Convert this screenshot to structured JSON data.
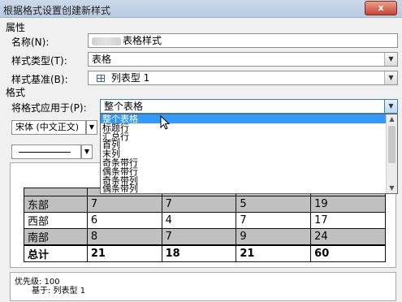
{
  "window": {
    "title": "根据格式设置创建新样式",
    "close_glyph": "x"
  },
  "properties": {
    "section_label": "属性",
    "name_label": "名称(N):",
    "name_value_suffix": "表格样式",
    "type_label": "样式类型(T):",
    "type_value": "表格",
    "based_on_label": "样式基准(B):",
    "based_on_value": "列表型 1",
    "based_on_icon": "table-icon"
  },
  "format": {
    "section_label": "格式",
    "apply_to_label": "将格式应用于(P):",
    "apply_to_value": "整个表格",
    "font_value": "宋体 (中文正文)",
    "apply_options": [
      "整个表格",
      "标题行",
      "汇总行",
      "首列",
      "末列",
      "奇条带行",
      "偶条带行",
      "奇条带列",
      "偶条带列"
    ],
    "selected_option_index": 0
  },
  "preview_table": {
    "rows": [
      {
        "style": "hdr",
        "cells": [
          "",
          "",
          "",
          "",
          ""
        ]
      },
      {
        "style": "shade",
        "cells": [
          "东部",
          "7",
          "7",
          "5",
          "19"
        ]
      },
      {
        "style": "plain",
        "cells": [
          "西部",
          "6",
          "4",
          "7",
          "17"
        ]
      },
      {
        "style": "shade",
        "cells": [
          "南部",
          "8",
          "7",
          "9",
          "24"
        ]
      },
      {
        "style": "total",
        "cells": [
          "总计",
          "21",
          "18",
          "21",
          "60"
        ]
      }
    ]
  },
  "info": {
    "priority_line": "优先级: 100",
    "based_on_line": "基于: 列表型 1"
  }
}
